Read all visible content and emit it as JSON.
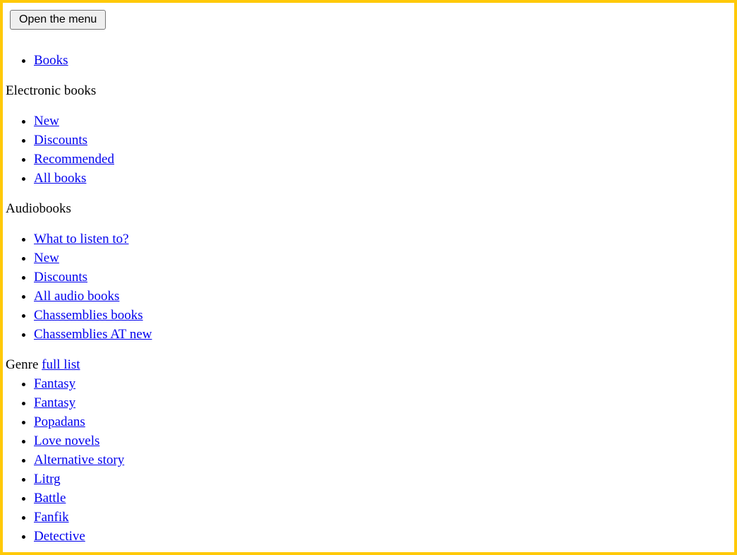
{
  "theme": {
    "frame_color": "#ffc907",
    "link_color": "#0000ee",
    "text_color": "#000000",
    "page_background": "#ffffff",
    "button_background": "#efefef",
    "button_border_color": "#767676"
  },
  "toolbar": {
    "menu_toggle_label": "Open the menu"
  },
  "menu": {
    "root_item_label": "Books",
    "sections": [
      {
        "heading": "Electronic books",
        "items": [
          {
            "label": "New"
          },
          {
            "label": "Discounts"
          },
          {
            "label": "Recommended"
          },
          {
            "label": "All books"
          }
        ]
      },
      {
        "heading": "Audiobooks",
        "items": [
          {
            "label": "What to listen to?"
          },
          {
            "label": "New"
          },
          {
            "label": "Discounts"
          },
          {
            "label": "All audio books"
          },
          {
            "label": "Chassemblies books"
          },
          {
            "label": "Chassemblies AT new"
          }
        ]
      }
    ],
    "genre": {
      "label": "Genre",
      "full_list_link_label": "full list",
      "items": [
        {
          "label": "Fantasy"
        },
        {
          "label": "Fantasy"
        },
        {
          "label": "Popadans"
        },
        {
          "label": "Love novels"
        },
        {
          "label": "Alternative story"
        },
        {
          "label": "Litrg"
        },
        {
          "label": "Battle"
        },
        {
          "label": "Fanfik"
        },
        {
          "label": "Detective"
        }
      ]
    }
  }
}
